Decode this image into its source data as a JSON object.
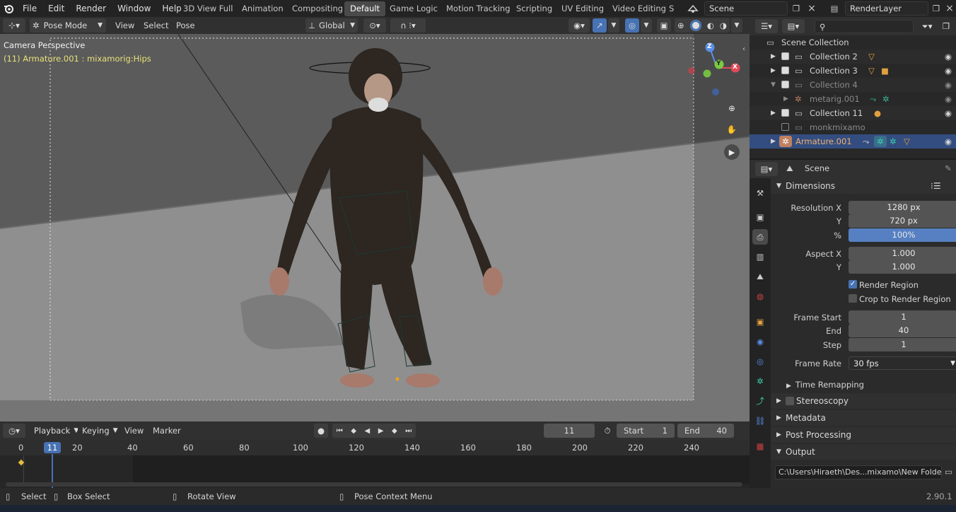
{
  "menubar": {
    "items": [
      "File",
      "Edit",
      "Render",
      "Window",
      "Help"
    ],
    "workspaces": [
      "3D View Full",
      "Animation",
      "Compositing",
      "Default",
      "Game Logic",
      "Motion Tracking",
      "Scripting",
      "UV Editing",
      "Video Editing",
      "S"
    ],
    "active_workspace": "Default",
    "scene": "Scene",
    "view_layer": "RenderLayer"
  },
  "viewport_header": {
    "mode": "Pose Mode",
    "menus": [
      "View",
      "Select",
      "Pose"
    ],
    "orientation": "Global"
  },
  "viewport": {
    "title": "Camera Perspective",
    "subtitle": "(11) Armature.001 : mixamorig:Hips",
    "gizmo_axes": [
      "Y",
      "X",
      "Z"
    ]
  },
  "timeline": {
    "menus": [
      "Playback",
      "Keying",
      "View",
      "Marker"
    ],
    "current_frame": "11",
    "start_label": "Start",
    "start_value": "1",
    "end_label": "End",
    "end_value": "40",
    "ruler": [
      "0",
      "11",
      "20",
      "40",
      "60",
      "80",
      "100",
      "120",
      "140",
      "160",
      "180",
      "200",
      "220",
      "240"
    ]
  },
  "statusbar": {
    "select": "Select",
    "box_select": "Box Select",
    "rotate_view": "Rotate View",
    "context_menu": "Pose Context Menu",
    "version": "2.90.1"
  },
  "outliner": {
    "header_label": "Scene Collection",
    "rows": [
      {
        "label": "Collection 2"
      },
      {
        "label": "Collection 3"
      },
      {
        "label": "Collection 4"
      },
      {
        "label": "metarig.001"
      },
      {
        "label": "Collection 11"
      },
      {
        "label": "monkmixamo"
      },
      {
        "label": "Armature.001"
      }
    ]
  },
  "properties": {
    "context": "Scene",
    "dimensions_title": "Dimensions",
    "resolution_x_label": "Resolution X",
    "resolution_x": "1280 px",
    "y_label": "Y",
    "resolution_y": "720 px",
    "percent_label": "%",
    "percent": "100%",
    "aspect_x_label": "Aspect X",
    "aspect_x": "1.000",
    "aspect_y_label": "Y",
    "aspect_y": "1.000",
    "render_region": "Render Region",
    "crop_region": "Crop to Render Region",
    "frame_start_label": "Frame Start",
    "frame_start": "1",
    "end_label": "End",
    "frame_end": "40",
    "step_label": "Step",
    "frame_step": "1",
    "frame_rate_label": "Frame Rate",
    "frame_rate": "30 fps",
    "time_remapping": "Time Remapping",
    "stereoscopy": "Stereoscopy",
    "metadata": "Metadata",
    "post_processing": "Post Processing",
    "output": "Output",
    "output_path": "C:\\Users\\Hiraeth\\Des...mixamo\\New Folder\\m"
  },
  "colors": {
    "accent": "#4772b3",
    "selection": "#334d80",
    "viewport_bg": "#6e6e6e",
    "playhead": "#4772b3"
  }
}
